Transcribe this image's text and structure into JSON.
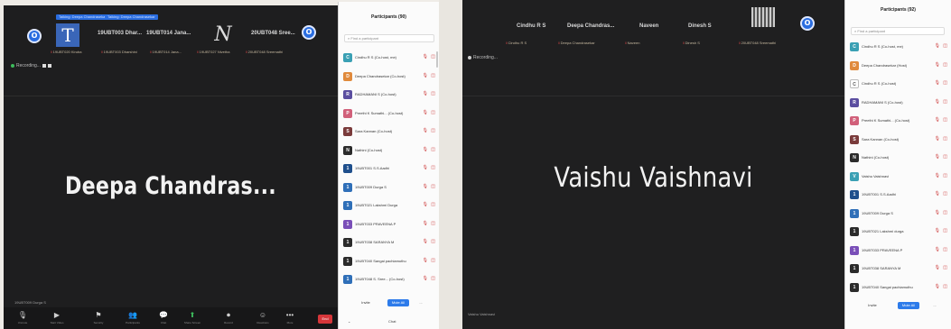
{
  "shot1": {
    "speaker_tags": [
      "Talking: Deepa Chandrasekar",
      "Talking: Deepa Chandrasekar"
    ],
    "tiles": [
      {
        "name": "19UBT003 Dhar...",
        "sub": "19UBT003 Dharshini"
      },
      {
        "name": "19UBT014 Jana...",
        "sub": "19UBT014 Jana..."
      },
      {
        "name": "20UBT048 Sree...",
        "sub": "20UBT048 Sreemathi"
      }
    ],
    "tile_letters": {
      "t": "T",
      "n": "N"
    },
    "tile_sub_extra": [
      "19UBT020 Kiruba"
    ],
    "recording_label": "Recording...",
    "active_speaker": "Deepa Chandras...",
    "corner_label": "19UBT009 Durga S",
    "toolbar": [
      {
        "icon": "mic-icon",
        "glyph": "🎙",
        "label": "Unmute"
      },
      {
        "icon": "video-icon",
        "glyph": "▶",
        "label": "Start Video"
      },
      {
        "icon": "security-icon",
        "glyph": "⚑",
        "label": "Security"
      },
      {
        "icon": "participants-icon",
        "glyph": "👥",
        "label": "Participants"
      },
      {
        "icon": "chat-icon",
        "glyph": "💬",
        "label": "Chat"
      },
      {
        "icon": "share-icon",
        "glyph": "⬆",
        "label": "Share Screen"
      },
      {
        "icon": "record-icon",
        "glyph": "⏺",
        "label": "Record"
      },
      {
        "icon": "reactions-icon",
        "glyph": "☺",
        "label": "Reactions"
      },
      {
        "icon": "more-icon",
        "glyph": "•••",
        "label": "More"
      }
    ],
    "end_label": "End",
    "participants": {
      "title": "Participants (90)",
      "search_placeholder": "Find a participant",
      "rows": [
        {
          "name": "Cindhu R S (Co-host, me)",
          "av": "C",
          "color": "#3aa0b4"
        },
        {
          "name": "Deepa Chandrasekar (Co-host)",
          "av": "D",
          "color": "#e08a3c"
        },
        {
          "name": "RADHAMANI S (Co-host)",
          "av": "R",
          "color": "#5b4ea0"
        },
        {
          "name": "Preethi K Sumathi... (Co-host)",
          "av": "P",
          "color": "#d1607a"
        },
        {
          "name": "Sara Kannan (Co-host)",
          "av": "S",
          "color": "#7a3b3b"
        },
        {
          "name": "Nathini (Co-host)",
          "av": "N",
          "color": "#2b2b2b"
        },
        {
          "name": "19UBT001 S.S.Aadhi",
          "av": "1",
          "color": "#1f4f8c"
        },
        {
          "name": "19UBT009 Durga S",
          "av": "1",
          "color": "#2f6fb8"
        },
        {
          "name": "19UBT021 Lakshmi Durga",
          "av": "1",
          "color": "#2f6fb8"
        },
        {
          "name": "19UBT033 PRAVEENA P",
          "av": "1",
          "color": "#7a4fb8"
        },
        {
          "name": "19UBT038 SARANYA M",
          "av": "1",
          "color": "#2b2b2b"
        },
        {
          "name": "19UBT040 Sangai pachiamuthu",
          "av": "1",
          "color": "#2b2b2b"
        },
        {
          "name": "19UBT048 S. Sree... (Co-host)",
          "av": "1",
          "color": "#2f6fb8"
        }
      ],
      "invite_label": "Invite",
      "mute_all_label": "Mute All",
      "more_label": "...",
      "chat_label": "Chat"
    }
  },
  "shot2": {
    "tiles": [
      {
        "name": "Cindhu R S",
        "sub": "Cindhu R S"
      },
      {
        "name": "Deepa Chandras...",
        "sub": "Deepa Chandrasekar"
      },
      {
        "name": "Naveen",
        "sub": "Naveen"
      },
      {
        "name": "Dinesh S",
        "sub": "Dinesh S"
      }
    ],
    "tile_sub_extra": [
      "20UBT048 Sreemathi"
    ],
    "recording_label": "Recording...",
    "active_speaker": "Vaishu Vaishnavi",
    "corner_label": "Vaishu Vaishnavi",
    "participants": {
      "title": "Participants (92)",
      "search_placeholder": "Find a participant",
      "rows": [
        {
          "name": "Cindhu R S (Co-host, me)",
          "av": "C",
          "color": "#3aa0b4"
        },
        {
          "name": "Deepa Chandrasekar (Host)",
          "av": "D",
          "color": "#e08a3c"
        },
        {
          "name": "Cindhu R S (Co-host)",
          "av": "C",
          "color": "#ffffff"
        },
        {
          "name": "RADHAMANI S (Co-host)",
          "av": "R",
          "color": "#5b4ea0"
        },
        {
          "name": "Preethi K Sumathi... (Co-host)",
          "av": "P",
          "color": "#d1607a"
        },
        {
          "name": "Sara Kannan (Co-host)",
          "av": "S",
          "color": "#7a3b3b"
        },
        {
          "name": "Nathini (Co-host)",
          "av": "N",
          "color": "#2b2b2b"
        },
        {
          "name": "Vaishu Vaishnavi",
          "av": "V",
          "color": "#3aa0b4"
        },
        {
          "name": "19UBT001 S.S.Aadhi",
          "av": "1",
          "color": "#1f4f8c"
        },
        {
          "name": "19UBT009 Durga S",
          "av": "1",
          "color": "#2f6fb8"
        },
        {
          "name": "19UBT021 Lakshmi durga",
          "av": "1",
          "color": "#2b2b2b"
        },
        {
          "name": "19UBT033 PRAVEENA P",
          "av": "1",
          "color": "#7a4fb8"
        },
        {
          "name": "19UBT038 SARANYA M",
          "av": "1",
          "color": "#2b2b2b"
        },
        {
          "name": "19UBT040 Sangai pachiamuthu",
          "av": "1",
          "color": "#2b2b2b"
        }
      ],
      "invite_label": "Invite",
      "mute_all_label": "Mute All",
      "more_label": "..."
    }
  }
}
